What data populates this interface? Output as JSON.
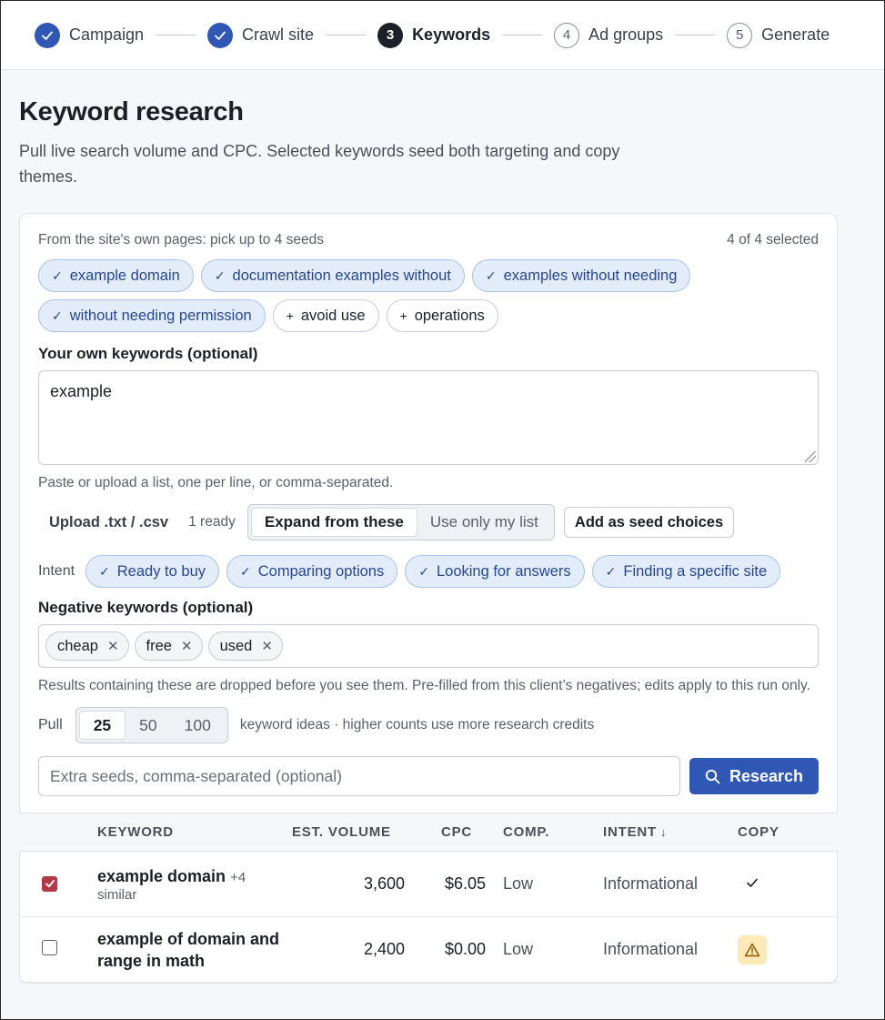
{
  "stepper": {
    "steps": [
      {
        "num": "✓",
        "label": "Campaign",
        "state": "done"
      },
      {
        "num": "✓",
        "label": "Crawl site",
        "state": "done"
      },
      {
        "num": "3",
        "label": "Keywords",
        "state": "active"
      },
      {
        "num": "4",
        "label": "Ad groups",
        "state": "todo"
      },
      {
        "num": "5",
        "label": "Generate",
        "state": "todo"
      }
    ]
  },
  "page": {
    "title": "Keyword research",
    "lede": "Pull live search volume and CPC. Selected keywords seed both targeting and copy themes."
  },
  "seeds": {
    "header": "From the site's own pages: pick up to 4 seeds",
    "count": "4 of 4 selected",
    "chips": [
      {
        "label": "example domain",
        "selected": true
      },
      {
        "label": "documentation examples without",
        "selected": true
      },
      {
        "label": "examples without needing",
        "selected": true
      },
      {
        "label": "without needing permission",
        "selected": true
      },
      {
        "label": "avoid use",
        "selected": false
      },
      {
        "label": "operations",
        "selected": false
      }
    ]
  },
  "own_keywords": {
    "label": "Your own keywords (optional)",
    "value": "example",
    "hint": "Paste or upload a list, one per line, or comma-separated.",
    "upload_label": "Upload .txt / .csv",
    "ready": "1 ready",
    "mode_options": [
      "Expand from these",
      "Use only my list"
    ],
    "mode_selected": "Expand from these",
    "add_seed_button": "Add as seed choices"
  },
  "intent": {
    "label": "Intent",
    "chips": [
      "Ready to buy",
      "Comparing options",
      "Looking for answers",
      "Finding a specific site"
    ]
  },
  "negatives": {
    "label": "Negative keywords (optional)",
    "tags": [
      "cheap",
      "free",
      "used"
    ],
    "hint": "Results containing these are dropped before you see them. Pre-filled from this client’s negatives; edits apply to this run only."
  },
  "pull": {
    "label": "Pull",
    "options": [
      "25",
      "50",
      "100"
    ],
    "selected": "25",
    "note": "keyword ideas · higher counts use more research credits"
  },
  "search": {
    "placeholder": "Extra seeds, comma-separated (optional)",
    "button": "Research"
  },
  "table": {
    "headers": {
      "keyword": "KEYWORD",
      "volume": "EST. VOLUME",
      "cpc": "CPC",
      "comp": "COMP.",
      "intent": "INTENT",
      "copy": "COPY"
    },
    "rows": [
      {
        "checked": true,
        "keyword": "example domain",
        "similar": "+4",
        "similar_suffix": "similar",
        "volume": "3,600",
        "cpc": "$6.05",
        "comp": "Low",
        "intent": "Informational",
        "copy": "ok"
      },
      {
        "checked": false,
        "keyword": "example of domain and range in math",
        "similar": "",
        "similar_suffix": "",
        "volume": "2,400",
        "cpc": "$0.00",
        "comp": "Low",
        "intent": "Informational",
        "copy": "warning"
      }
    ]
  },
  "colors": {
    "primary": "#2f57b3",
    "chip_selected_bg": "#e3ecf9",
    "checkbox_checked": "#b23a48",
    "warning_bg": "#fdeab8"
  }
}
